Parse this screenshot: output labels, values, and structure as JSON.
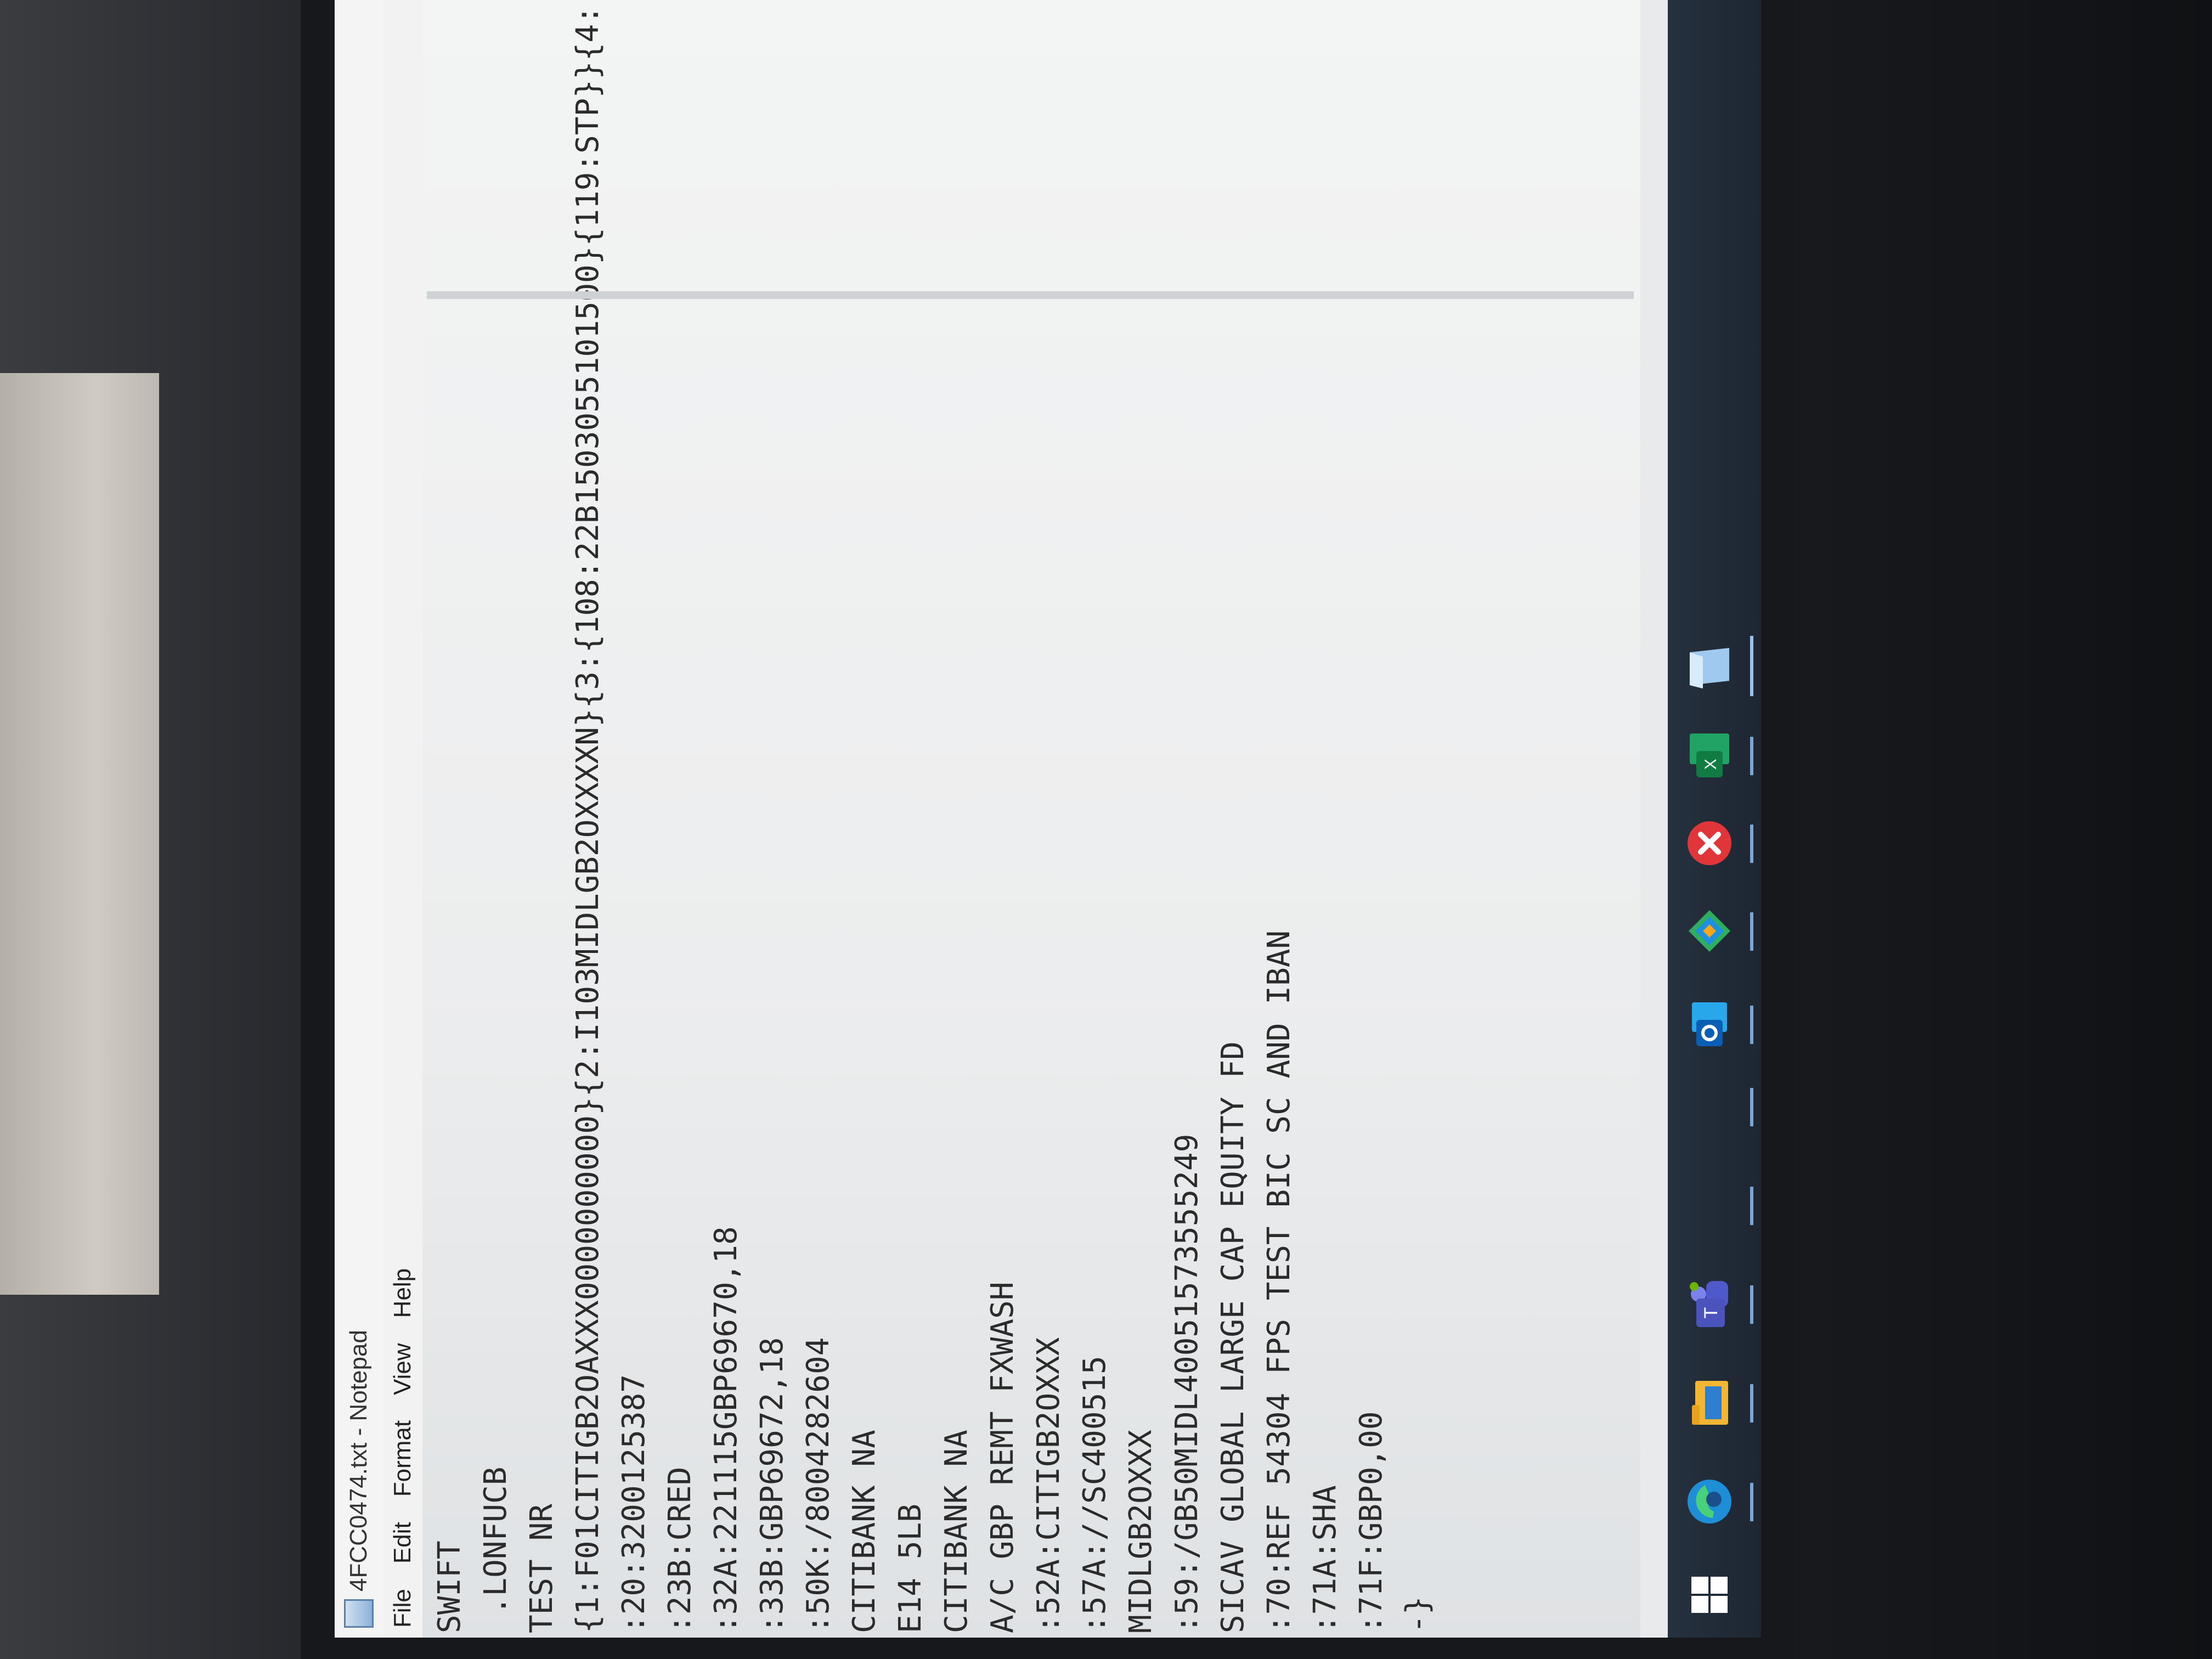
{
  "window": {
    "title": "4FCC0474.txt - Notepad",
    "menu": [
      "File",
      "Edit",
      "Format",
      "View",
      "Help"
    ]
  },
  "document": {
    "lines": [
      "SWIFT",
      " .LONFUCB",
      "TEST NR",
      "{1:F01CITIGB2OAXXX0000000000}{2:I103MIDLGB2OXXXXN}{3:{108:22B1503055101500}{119:STP}}{4:",
      ":20:3200125387",
      ":23B:CRED",
      ":32A:221115GBP69670,18",
      ":33B:GBP69672,18",
      ":50K:/8004282604",
      "CITIBANK NA",
      "E14 5LB",
      "CITIBANK NA",
      "A/C GBP REMT FXWASH",
      ":52A:CITIGB2OXXX",
      ":57A://SC400515",
      "MIDLGB2OXXX",
      ":59:/GB50MIDL40051573555249",
      "SICAV GLOBAL LARGE CAP EQUITY FD",
      ":70:REF 54304 FPS TEST BIC SC AND IBAN",
      ":71A:SHA",
      ":71F:GBP0,00",
      "-}"
    ]
  },
  "taskbar": {
    "icons": [
      "windows-start-icon",
      "edge-browser-icon",
      "file-explorer-icon",
      "teams-icon",
      "outlook-icon",
      "app-launcher-icon",
      "error-app-icon",
      "excel-icon",
      "notepad-icon"
    ]
  },
  "colors": {
    "taskbar": "#1d2631",
    "window_bg": "#ecedee",
    "text": "#2b2b2b"
  }
}
